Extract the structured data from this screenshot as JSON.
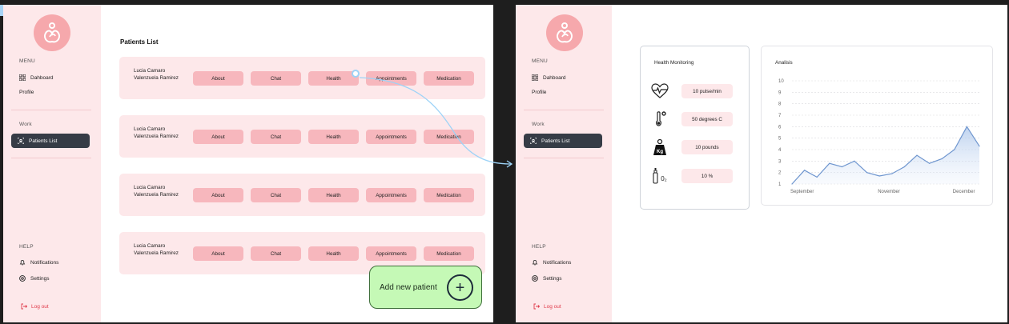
{
  "patients_screen": {
    "menu_label": "MENU",
    "nav_dashboard": "Dahboard",
    "nav_profile": "Profile",
    "work_label": "Work",
    "nav_patients": "Patients List",
    "help_label": "HELP",
    "nav_notifications": "Notifications",
    "nav_settings": "Settings",
    "logout": "Log out",
    "title": "Patients List",
    "patients": [
      {
        "name": "Lucia Camaro Valenzuela Ramirez"
      },
      {
        "name": "Lucia Camaro Valenzuela Ramirez"
      },
      {
        "name": "Lucia Camaro Valenzuela Ramirez"
      },
      {
        "name": "Lucia Camaro Valenzuela Ramirez"
      }
    ],
    "actions": [
      "About",
      "Chat",
      "Health",
      "Appointments",
      "Medication"
    ],
    "add_patient": "Add new patient",
    "add_icon": "+"
  },
  "health_screen": {
    "menu_label": "MENU",
    "nav_dashboard": "Dahboard",
    "nav_profile": "Profile",
    "work_label": "Work",
    "nav_patients": "Patients List",
    "help_label": "HELP",
    "nav_notifications": "Notifications",
    "nav_settings": "Settings",
    "logout": "Log out",
    "monitoring_title": "Health Monitoring",
    "metrics": [
      {
        "icon": "heartbeat-icon",
        "value": "10 pulse/min"
      },
      {
        "icon": "thermometer-icon",
        "value": "50 degrees C"
      },
      {
        "icon": "weight-icon",
        "value": "10 pounds",
        "icon_text": "Kg"
      },
      {
        "icon": "oxygen-icon",
        "value": "10 %",
        "icon_text": "0₂"
      }
    ],
    "analysis_title": "Analisis"
  },
  "colors": {
    "sidebar": "#fde8ea",
    "pill": "#f7b7bd",
    "accent_dark": "#363c46",
    "logout": "#e03a4a",
    "add_button": "#c5f9b6",
    "chart_line": "#6f96cf"
  },
  "chart_data": {
    "type": "area",
    "y_ticks": [
      1,
      2,
      3,
      4,
      5,
      6,
      7,
      8,
      9,
      10
    ],
    "ylim": [
      1,
      10
    ],
    "x_labels": [
      "September",
      "November",
      "December"
    ],
    "x_label_positions": [
      1,
      8,
      14
    ],
    "x": [
      1,
      2,
      3,
      4,
      5,
      6,
      7,
      8,
      9,
      10,
      11,
      12,
      13,
      14,
      15,
      16
    ],
    "values": [
      1.0,
      2.2,
      1.6,
      2.8,
      2.5,
      3.0,
      2.0,
      1.7,
      1.9,
      2.5,
      3.5,
      2.8,
      3.2,
      4.0,
      6.0,
      4.3
    ],
    "grid": true,
    "series": [
      {
        "name": "",
        "values": [
          1.0,
          2.2,
          1.6,
          2.8,
          2.5,
          3.0,
          2.0,
          1.7,
          1.9,
          2.5,
          3.5,
          2.8,
          3.2,
          4.0,
          6.0,
          4.3
        ]
      }
    ]
  }
}
